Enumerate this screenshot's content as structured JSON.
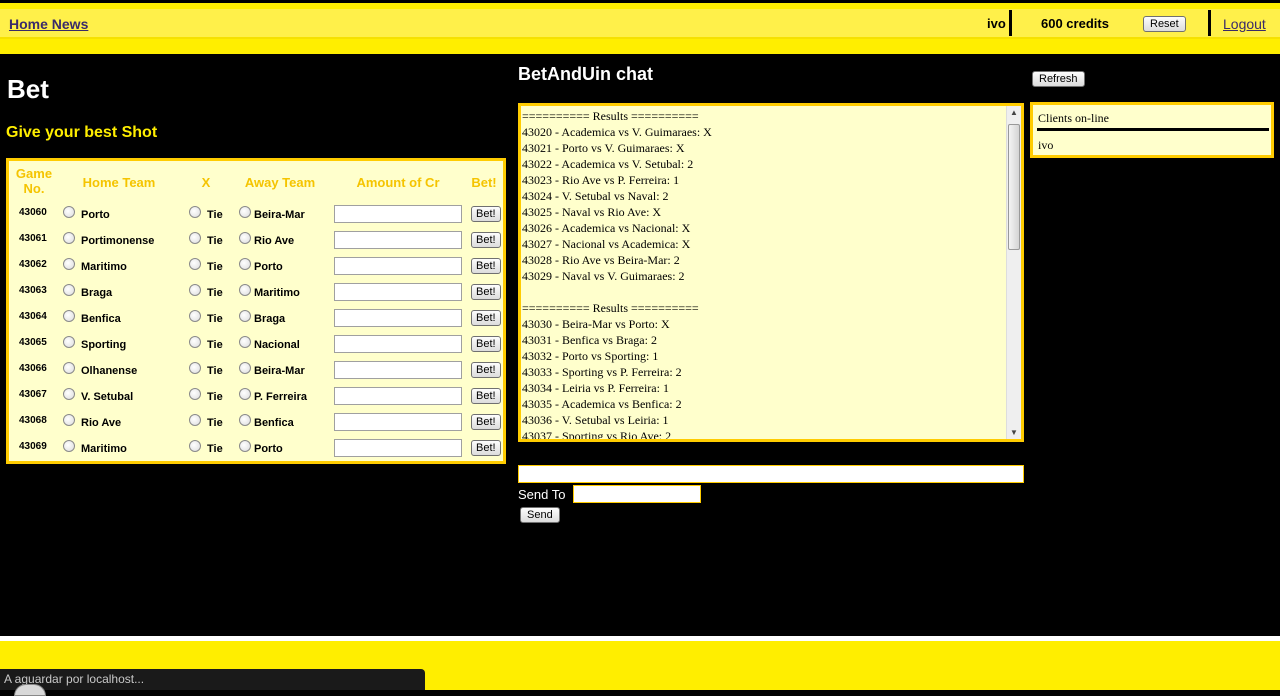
{
  "header": {
    "home_link": "Home News",
    "username": "ivo",
    "credits": "600 credits",
    "reset_label": "Reset",
    "logout_label": "Logout"
  },
  "bet": {
    "title": "Bet",
    "subtitle": "Give your best Shot",
    "columns": {
      "game_no_1": "Game",
      "game_no_2": "No.",
      "home": "Home Team",
      "x": "X",
      "away": "Away Team",
      "amount": "Amount of Cr",
      "bet": "Bet!"
    },
    "tie_label": "Tie",
    "bet_button_label": "Bet!",
    "games": [
      {
        "id": "43060",
        "home": "Porto",
        "away": "Beira-Mar"
      },
      {
        "id": "43061",
        "home": "Portimonense",
        "away": "Rio Ave"
      },
      {
        "id": "43062",
        "home": "Maritimo",
        "away": "Porto"
      },
      {
        "id": "43063",
        "home": "Braga",
        "away": "Maritimo"
      },
      {
        "id": "43064",
        "home": "Benfica",
        "away": "Braga"
      },
      {
        "id": "43065",
        "home": "Sporting",
        "away": "Nacional"
      },
      {
        "id": "43066",
        "home": "Olhanense",
        "away": "Beira-Mar"
      },
      {
        "id": "43067",
        "home": "V. Setubal",
        "away": "P. Ferreira"
      },
      {
        "id": "43068",
        "home": "Rio Ave",
        "away": "Benfica"
      },
      {
        "id": "43069",
        "home": "Maritimo",
        "away": "Porto"
      }
    ]
  },
  "chat": {
    "title": "BetAndUin chat",
    "lines": [
      "========== Results ==========",
      "43020 - Academica vs V. Guimaraes: X",
      "43021 - Porto vs V. Guimaraes: X",
      "43022 - Academica vs V. Setubal: 2",
      "43023 - Rio Ave vs P. Ferreira: 1",
      "43024 - V. Setubal vs Naval: 2",
      "43025 - Naval vs Rio Ave: X",
      "43026 - Academica vs Nacional: X",
      "43027 - Nacional vs Academica: X",
      "43028 - Rio Ave vs Beira-Mar: 2",
      "43029 - Naval vs V. Guimaraes: 2",
      "",
      "========== Results ==========",
      "43030 - Beira-Mar vs Porto: X",
      "43031 - Benfica vs Braga: 2",
      "43032 - Porto vs Sporting: 1",
      "43033 - Sporting vs P. Ferreira: 2",
      "43034 - Leiria vs P. Ferreira: 1",
      "43035 - Academica vs Benfica: 2",
      "43036 - V. Setubal vs Leiria: 1",
      "43037 - Sporting vs Rio Ave: 2"
    ],
    "send_to_label": "Send To",
    "send_label": "Send"
  },
  "clients": {
    "refresh_label": "Refresh",
    "title": "Clients on-line",
    "names": [
      "ivo"
    ]
  },
  "status_bar": {
    "text": "A aguardar por localhost..."
  },
  "colors": {
    "accent_yellow": "#ffee00",
    "panel_bg": "#ffffcc",
    "panel_border": "#ffcc00",
    "header_text": "#f5c400"
  }
}
